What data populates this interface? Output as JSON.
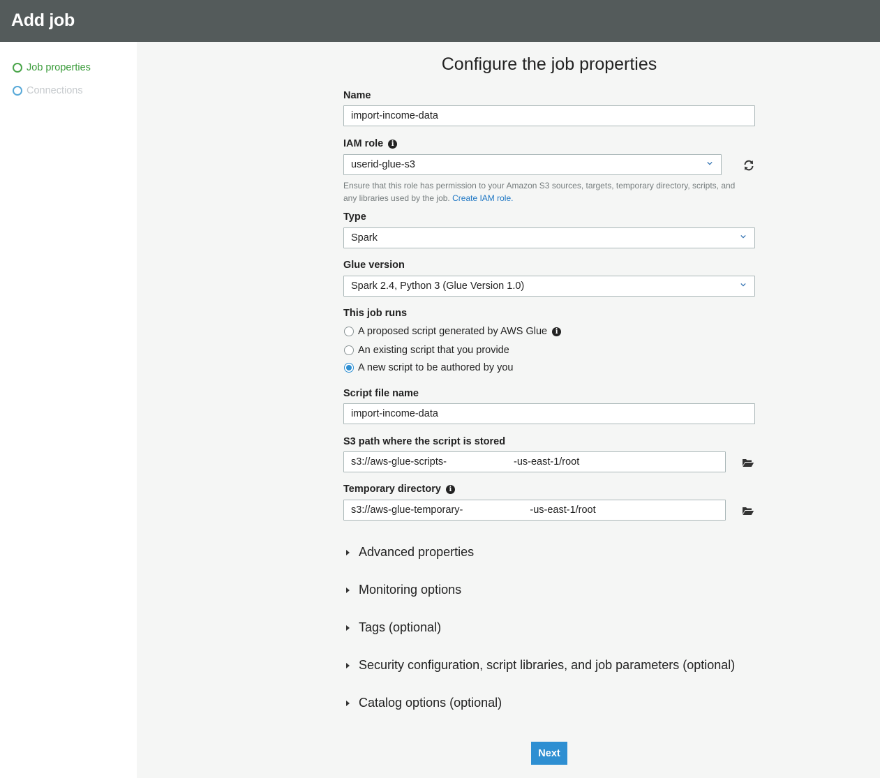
{
  "header": {
    "title": "Add job"
  },
  "sidebar": {
    "steps": [
      {
        "label": "Job properties",
        "state": "active"
      },
      {
        "label": "Connections",
        "state": "pending"
      }
    ]
  },
  "main": {
    "title": "Configure the job properties",
    "name": {
      "label": "Name",
      "value": "import-income-data"
    },
    "iam_role": {
      "label": "IAM role",
      "value": "userid-glue-s3",
      "help": "Ensure that this role has permission to your Amazon S3 sources, targets, temporary directory, scripts, and any libraries used by the job.",
      "help_link": "Create IAM role."
    },
    "type": {
      "label": "Type",
      "value": "Spark"
    },
    "glue_version": {
      "label": "Glue version",
      "value": "Spark 2.4, Python 3 (Glue Version 1.0)"
    },
    "job_runs": {
      "label": "This job runs",
      "options": [
        "A proposed script generated by AWS Glue",
        "An existing script that you provide",
        "A new script to be authored by you"
      ],
      "selected_index": 2
    },
    "script_file_name": {
      "label": "Script file name",
      "value": "import-income-data"
    },
    "s3_path": {
      "label": "S3 path where the script is stored",
      "value_prefix": "s3://aws-glue-scripts-",
      "value_suffix": "-us-east-1/root"
    },
    "temp_dir": {
      "label": "Temporary directory",
      "value_prefix": "s3://aws-glue-temporary-",
      "value_suffix": "-us-east-1/root"
    },
    "sections": [
      "Advanced properties",
      "Monitoring options",
      "Tags (optional)",
      "Security configuration, script libraries, and job parameters (optional)",
      "Catalog options (optional)"
    ],
    "next_label": "Next"
  },
  "colors": {
    "header_bg": "#545b5b",
    "accent_blue": "#2e8fd2",
    "step_active": "#3a9b3a",
    "link": "#1f77c4"
  }
}
